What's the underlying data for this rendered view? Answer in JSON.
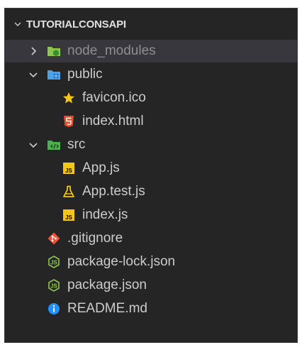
{
  "explorer": {
    "section_title": "TUTORIALCONSAPI",
    "items": [
      {
        "label": "node_modules",
        "type": "folder",
        "expanded": false,
        "icon": "node-folder-icon"
      },
      {
        "label": "public",
        "type": "folder",
        "expanded": true,
        "icon": "public-folder-icon"
      },
      {
        "label": "favicon.ico",
        "type": "file",
        "icon": "star-icon"
      },
      {
        "label": "index.html",
        "type": "file",
        "icon": "html5-icon"
      },
      {
        "label": "src",
        "type": "folder",
        "expanded": true,
        "icon": "src-folder-icon"
      },
      {
        "label": "App.js",
        "type": "file",
        "icon": "js-icon"
      },
      {
        "label": "App.test.js",
        "type": "file",
        "icon": "test-flask-icon"
      },
      {
        "label": "index.js",
        "type": "file",
        "icon": "js-icon"
      },
      {
        "label": ".gitignore",
        "type": "file",
        "icon": "git-icon"
      },
      {
        "label": "package-lock.json",
        "type": "file",
        "icon": "nodejs-icon"
      },
      {
        "label": "package.json",
        "type": "file",
        "icon": "nodejs-icon"
      },
      {
        "label": "README.md",
        "type": "file",
        "icon": "info-icon"
      }
    ]
  },
  "colors": {
    "background": "#252526",
    "selected_row": "#37373d",
    "text": "#cccccc",
    "dim_text": "#8f8f8f",
    "node_green": "#8cc84b",
    "folder_blue": "#4aa3e8",
    "js_yellow": "#f5c518",
    "html_orange": "#e44d26",
    "git_orange": "#f05133",
    "info_blue": "#1e90ff"
  }
}
